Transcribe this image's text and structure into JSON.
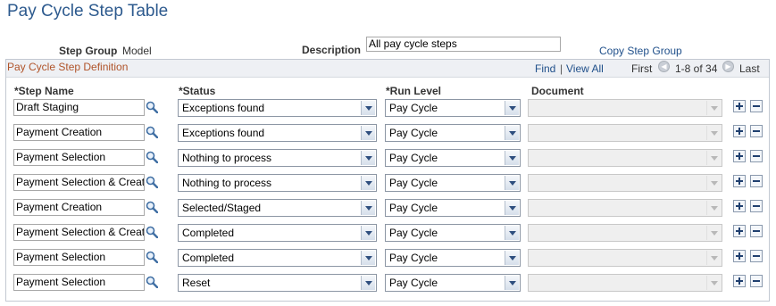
{
  "page": {
    "title": "Pay Cycle Step Table"
  },
  "header": {
    "step_group_label": "Step Group",
    "step_group_value": "Model",
    "description_label": "Description",
    "description_value": "All pay cycle steps",
    "copy_link": "Copy Step Group"
  },
  "grid": {
    "title": "Pay Cycle Step Definition",
    "find": "Find",
    "separator": "|",
    "view_all": "View All",
    "first": "First",
    "range": "1-8 of 34",
    "last": "Last",
    "columns": {
      "step_name": "*Step Name",
      "status": "*Status",
      "run_level": "*Run Level",
      "document": "Document"
    },
    "rows": [
      {
        "step_name": "Draft Staging",
        "status": "Exceptions found",
        "run_level": "Pay Cycle",
        "document": ""
      },
      {
        "step_name": "Payment Creation",
        "status": "Exceptions found",
        "run_level": "Pay Cycle",
        "document": ""
      },
      {
        "step_name": "Payment Selection",
        "status": "Nothing to process",
        "run_level": "Pay Cycle",
        "document": ""
      },
      {
        "step_name": "Payment Selection & Creat",
        "status": "Nothing to process",
        "run_level": "Pay Cycle",
        "document": ""
      },
      {
        "step_name": "Payment Creation",
        "status": "Selected/Staged",
        "run_level": "Pay Cycle",
        "document": ""
      },
      {
        "step_name": "Payment Selection & Creat",
        "status": "Completed",
        "run_level": "Pay Cycle",
        "document": ""
      },
      {
        "step_name": "Payment Selection",
        "status": "Completed",
        "run_level": "Pay Cycle",
        "document": ""
      },
      {
        "step_name": "Payment Selection",
        "status": "Reset",
        "run_level": "Pay Cycle",
        "document": ""
      }
    ]
  },
  "icons": {
    "lookup": "magnifier-icon",
    "add": "plus-icon",
    "delete": "minus-icon",
    "prev": "left-arrow-icon",
    "next": "right-arrow-icon"
  }
}
